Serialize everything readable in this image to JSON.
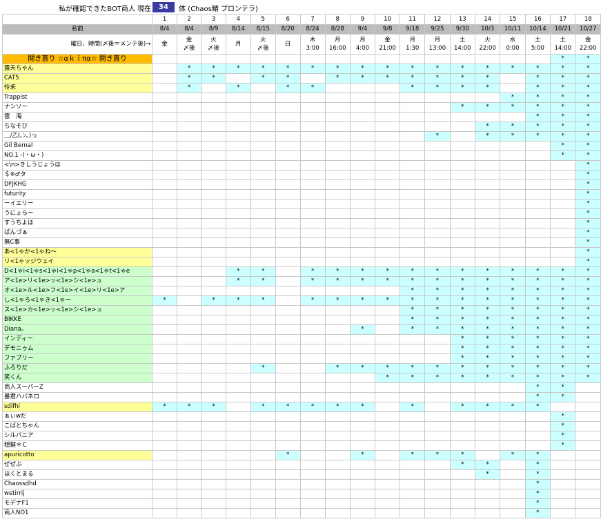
{
  "title": {
    "left": "私が確認できたBOT商人  現在",
    "count": "34",
    "right": "体 (Chaos鯖 プロンテラ)"
  },
  "header": {
    "names_label": "名前",
    "day_label": "曜日、時間(〆後＝メンテ後)→",
    "section_label": "開き直り  ☆αｋｉπα☆  開き直り",
    "columns": [
      {
        "num": "1",
        "date": "8/4",
        "day": "金",
        "time": ""
      },
      {
        "num": "2",
        "date": "8/4",
        "day": "金",
        "time": "〆後"
      },
      {
        "num": "3",
        "date": "8/9",
        "day": "火",
        "time": "〆後"
      },
      {
        "num": "4",
        "date": "8/14",
        "day": "月",
        "time": ""
      },
      {
        "num": "5",
        "date": "8/15",
        "day": "火",
        "time": "〆後"
      },
      {
        "num": "6",
        "date": "8/20",
        "day": "日",
        "time": ""
      },
      {
        "num": "7",
        "date": "8/24",
        "day": "木",
        "time": "3:00"
      },
      {
        "num": "8",
        "date": "8/28",
        "day": "月",
        "time": "16:00"
      },
      {
        "num": "9",
        "date": "9/4",
        "day": "月",
        "time": "4:00"
      },
      {
        "num": "10",
        "date": "9/8",
        "day": "金",
        "time": "21:00"
      },
      {
        "num": "11",
        "date": "9/18",
        "day": "月",
        "time": "1:30"
      },
      {
        "num": "12",
        "date": "9/25",
        "day": "月",
        "time": "13:00"
      },
      {
        "num": "13",
        "date": "9/30",
        "day": "土",
        "time": "14:00"
      },
      {
        "num": "14",
        "date": "10/3",
        "day": "火",
        "time": "22:00"
      },
      {
        "num": "15",
        "date": "10/11",
        "day": "水",
        "time": "0:00"
      },
      {
        "num": "16",
        "date": "10/14",
        "day": "土",
        "time": "5:00"
      },
      {
        "num": "17",
        "date": "10/21",
        "day": "土",
        "time": "14:00"
      },
      {
        "num": "18",
        "date": "10/27",
        "day": "金",
        "time": "22:00"
      }
    ]
  },
  "section_marks": "................**",
  "rows": [
    {
      "name": "露天ちゃん",
      "bg": "yellow",
      "marks": ".*****************"
    },
    {
      "name": "CAT5",
      "bg": "yellow",
      "marks": ".**.**.*******.***"
    },
    {
      "name": "怜禾",
      "bg": "yellow",
      "marks": ".*.*.**...****.***"
    },
    {
      "name": "Trappist",
      "bg": "white",
      "marks": "..............****"
    },
    {
      "name": "ナンソー",
      "bg": "white",
      "marks": "............******"
    },
    {
      "name": "雲　海",
      "bg": "white",
      "marks": "...............***"
    },
    {
      "name": "ちなそび",
      "bg": "white",
      "marks": ".............*****"
    },
    {
      "name": "＿/乙(､ﾝ､)っ",
      "bg": "white",
      "marks": "...........*.*****"
    },
    {
      "name": "Gil Bernal",
      "bg": "white",
      "marks": "................**"
    },
    {
      "name": "NO.1 -(・ω・)",
      "bg": "white",
      "marks": "................**"
    },
    {
      "name": "<\\n>きしうじょうほ",
      "bg": "white",
      "marks": ".................*"
    },
    {
      "name": "＄※♂タ",
      "bg": "white",
      "marks": ".................*"
    },
    {
      "name": "DFJKHG",
      "bg": "white",
      "marks": ".................*"
    },
    {
      "name": "futurity",
      "bg": "white",
      "marks": ".................*"
    },
    {
      "name": "ーイエリー",
      "bg": "white",
      "marks": ".................*"
    },
    {
      "name": "うにょらー",
      "bg": "white",
      "marks": ".................*"
    },
    {
      "name": "すうちよほ",
      "bg": "white",
      "marks": ".................*"
    },
    {
      "name": "ぱんづぁ",
      "bg": "white",
      "marks": ".................*"
    },
    {
      "name": "無C事",
      "bg": "white",
      "marks": ".................*"
    },
    {
      "name": "あ<1ゃか<1ゃね～",
      "bg": "yellow",
      "marks": ".................*"
    },
    {
      "name": "リ<1ゃッジウェイ",
      "bg": "yellow",
      "marks": ".................*"
    },
    {
      "name": "D<1ゃi<1ゃs<1ゃi<1ゃp<1ゃa<1ゃt<1ゃe",
      "bg": "green",
      "marks": "...**.************"
    },
    {
      "name": "ア<1e>リ<1e>ッ<1e>シ<1e>ュ",
      "bg": "green",
      "marks": "...**.************"
    },
    {
      "name": "オ<1e>ル<1e>フ<1e>イ<1e>リ<1e>ア",
      "bg": "green",
      "marks": "..........********"
    },
    {
      "name": "し<1ゃろ<1ゃき<1ゃー",
      "bg": "green",
      "marks": "*.***.************"
    },
    {
      "name": "ス<1e>カ<1e>ッ<1e>シ<1e>ュ",
      "bg": "green",
      "marks": "..........********"
    },
    {
      "name": "BIKKE",
      "bg": "green",
      "marks": "..........********"
    },
    {
      "name": "Diana。",
      "bg": "green",
      "marks": "........*.********"
    },
    {
      "name": "インディー",
      "bg": "green",
      "marks": "............******"
    },
    {
      "name": "デモニゥム",
      "bg": "green",
      "marks": "............******"
    },
    {
      "name": "ファブリー",
      "bg": "green",
      "marks": "............******"
    },
    {
      "name": "ふろりだ",
      "bg": "green",
      "marks": "....*..***********"
    },
    {
      "name": "笑くん",
      "bg": "green",
      "marks": ".........*********"
    },
    {
      "name": "商人スーパーZ",
      "bg": "white",
      "marks": "...............**."
    },
    {
      "name": "暴君ハバネロ",
      "bg": "white",
      "marks": "...............**."
    },
    {
      "name": "sdifhi",
      "bg": "yellow",
      "marks": "***.*****.*.****.."
    },
    {
      "name": "ぁぃwだ",
      "bg": "white",
      "marks": "................*."
    },
    {
      "name": "こばとちゃん",
      "bg": "white",
      "marks": "................*."
    },
    {
      "name": "シルバニア",
      "bg": "white",
      "marks": "................*."
    },
    {
      "name": "穏鍵＊Ｃ",
      "bg": "white",
      "marks": "................*."
    },
    {
      "name": "apuricotto",
      "bg": "yellow",
      "marks": ".....*..*.***.**.."
    },
    {
      "name": "ぜぜぶ",
      "bg": "white",
      "marks": "............**.*.."
    },
    {
      "name": "ほくとまる",
      "bg": "white",
      "marks": ".............*.*.."
    },
    {
      "name": "Chaossdhd",
      "bg": "white",
      "marks": "...............*.."
    },
    {
      "name": "wetirrij",
      "bg": "white",
      "marks": "...............*.."
    },
    {
      "name": "モデナF1",
      "bg": "white",
      "marks": "...............*.."
    },
    {
      "name": "商人NO1",
      "bg": "white",
      "marks": "...............*.."
    }
  ],
  "mark_symbol": "*",
  "colors": {
    "header_bg": "#bdbdbd",
    "count_bg": "#3a3aa0",
    "section_bg": "#ffbb00",
    "mark_bg": "#ccffff",
    "yellow_row": "#ffff99",
    "green_row": "#ccffcc"
  }
}
